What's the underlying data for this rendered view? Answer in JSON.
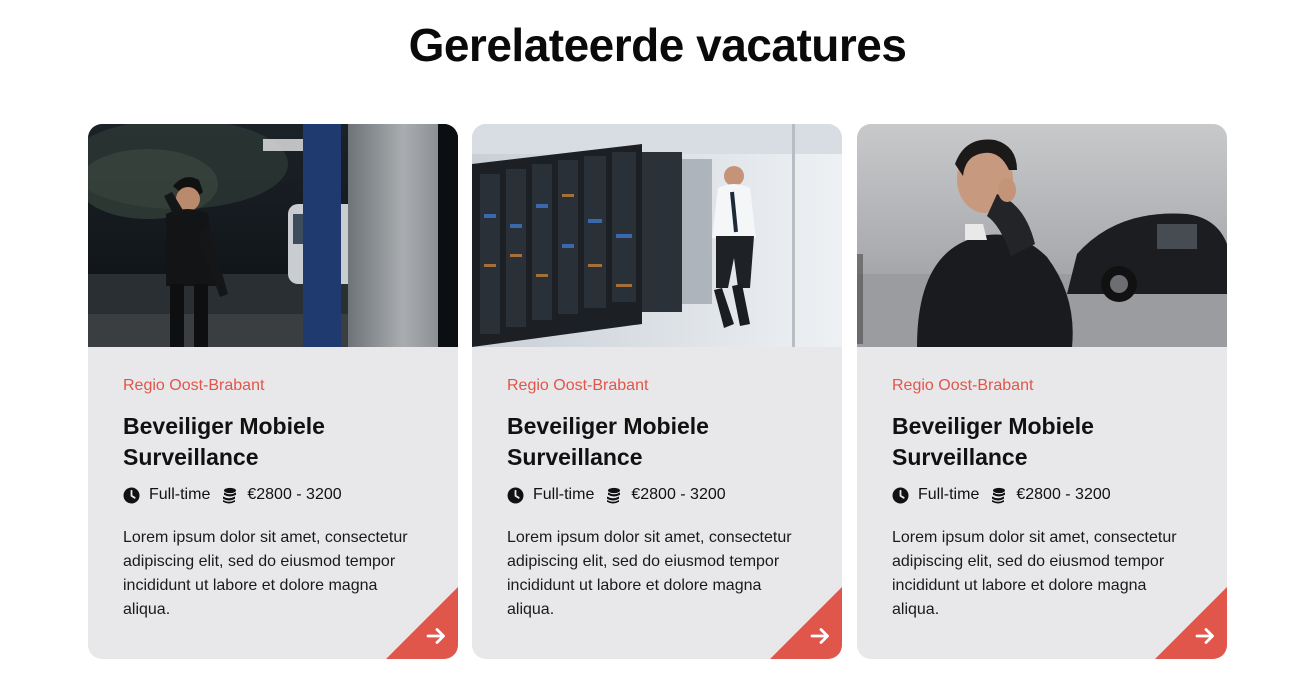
{
  "page": {
    "title": "Gerelateerde vacatures"
  },
  "colors": {
    "accent": "#e0564b",
    "card_bg": "#e8e8ea",
    "text": "#111111"
  },
  "cards": [
    {
      "image": "security-guard-night-photo",
      "region": "Regio Oost-Brabant",
      "title": "Beveiliger Mobiele Surveillance",
      "employment": "Full-time",
      "salary": "€2800 - 3200",
      "description": "Lorem ipsum dolor sit amet, consectetur adipiscing elit, sed do eiusmod tempor incididunt ut labore et dolore magna aliqua.",
      "icons": [
        "clock-icon",
        "coins-icon",
        "arrow-right-icon"
      ]
    },
    {
      "image": "data-center-guard-photo",
      "region": "Regio Oost-Brabant",
      "title": "Beveiliger Mobiele Surveillance",
      "employment": "Full-time",
      "salary": "€2800 - 3200",
      "description": "Lorem ipsum dolor sit amet, consectetur adipiscing elit, sed do eiusmod tempor incididunt ut labore et dolore magna aliqua.",
      "icons": [
        "clock-icon",
        "coins-icon",
        "arrow-right-icon"
      ]
    },
    {
      "image": "bodyguard-earpiece-photo",
      "region": "Regio Oost-Brabant",
      "title": "Beveiliger Mobiele Surveillance",
      "employment": "Full-time",
      "salary": "€2800 - 3200",
      "description": "Lorem ipsum dolor sit amet, consectetur adipiscing elit, sed do eiusmod tempor incididunt ut labore et dolore magna aliqua.",
      "icons": [
        "clock-icon",
        "coins-icon",
        "arrow-right-icon"
      ]
    }
  ]
}
